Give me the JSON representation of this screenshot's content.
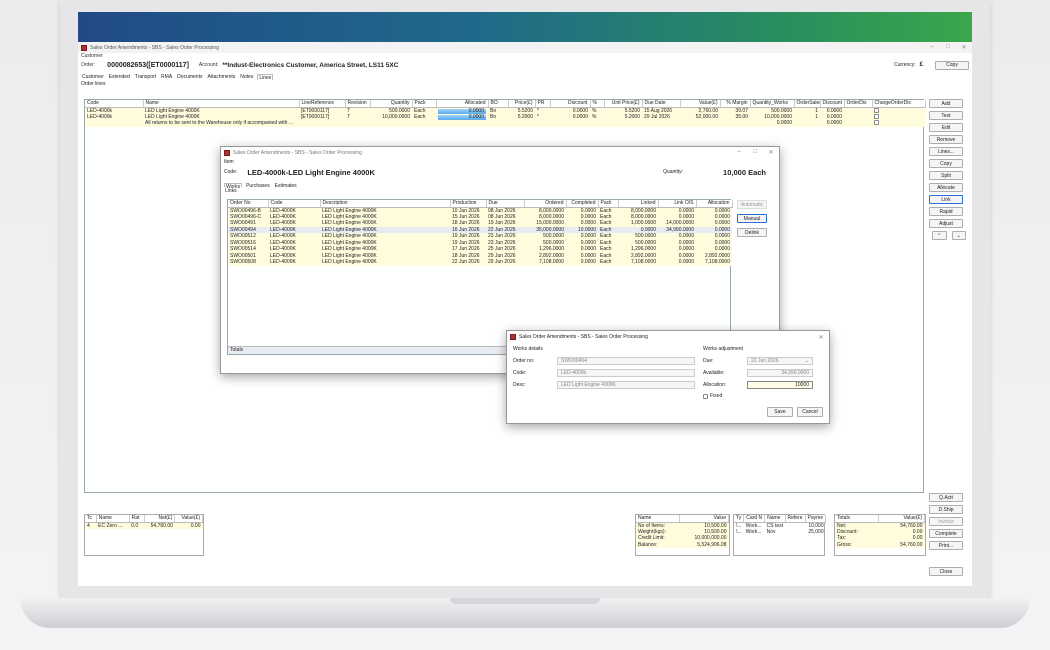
{
  "main": {
    "title": "Sales Order Amendments - SBS - Sales Order Processing",
    "customer_label": "Customer",
    "order_label": "Order:",
    "order_no": "0000082653([ET0000117]",
    "account_label": "Account:",
    "account_value": "**Indust-Electronics Customer, America Street, LS11 5XC",
    "currency_label": "Currency:",
    "currency_symbol": "£",
    "copy_button": "Copy",
    "tabs": [
      "Customer",
      "Extended",
      "Transport",
      "RMA",
      "Documents",
      "Attachments",
      "Notes",
      "Lines"
    ],
    "group_label": "Order lines",
    "columns": [
      "Code",
      "Name",
      "LineReference",
      "Revision",
      "Quantity",
      "Pack",
      "Allocated",
      "BO",
      "Price(£)",
      "PR",
      "Discount",
      "%",
      "Unit Price(£)",
      "Due Date",
      "Value(£)",
      "% Margin",
      "Quantity_Works",
      "OrderSales",
      "Discount",
      "OrderDis",
      "ChargeOrderDis"
    ],
    "rows": [
      {
        "code": "LED-4000k",
        "name": "LED Light Engine 4000K",
        "ref": "[ET0000117]",
        "rev": "7",
        "qty": "500.0000",
        "pack": "Each",
        "alloc": "0.0000",
        "bo": "Bo",
        "price": "5.5200",
        "pr": "*",
        "disc": "0.0000",
        "pct": "%",
        "unit": "5.5200",
        "due": "15 Aug 2026",
        "value": "2,760.00",
        "margin": "39.07",
        "qworks": "500.0000",
        "osales": "1",
        "disc2": "0.0000"
      },
      {
        "code": "LED-4000k",
        "name": "LED Light Engine 4000K",
        "ref": "[ET0000117]",
        "rev": "7",
        "qty": "10,000.0000",
        "pack": "Each",
        "alloc": "0.0000",
        "bo": "Bo",
        "price": "5.2000",
        "pr": "*",
        "disc": "0.0000",
        "pct": "%",
        "unit": "5.2000",
        "due": "29 Jul 2026",
        "value": "52,000.00",
        "margin": "35.00",
        "qworks": "10,000.0000",
        "osales": "1",
        "disc2": "0.0000"
      }
    ],
    "note_row": {
      "name": "All returns to be sent to the Warehouse only if accompanied with ...",
      "qworks": "0.0000",
      "disc2": "0.0000"
    },
    "right_buttons": [
      "Add",
      "Text",
      "Edit",
      "Remove",
      "Lines...",
      "Copy",
      "Split",
      "Allocate",
      "Link",
      "Rapid",
      "Adjust"
    ],
    "right_buttons2": [
      "Q.Actt",
      "D.Ship",
      "Invoice",
      "Complete",
      "Print..."
    ],
    "close_button": "Close",
    "tax_panel": {
      "columns": [
        "Tc",
        "Name",
        "Rat",
        "Net(£)",
        "Value(£)"
      ],
      "row": [
        "4",
        "EC Zero ...",
        "0.0",
        "54,760.00",
        "0.00"
      ]
    },
    "info_panel": {
      "columns": [
        "Name",
        "Value"
      ],
      "rows": [
        [
          "No of Items:",
          "10,500.00"
        ],
        [
          "Weight(kgs):",
          "10,500.00"
        ],
        [
          "Credit Limit:",
          "10,000,000.00"
        ],
        [
          "Balance:",
          "5,524,906.08"
        ]
      ]
    },
    "card_panel": {
      "columns": [
        "Ty",
        "Card N",
        "Name",
        "Refere",
        "Payme"
      ],
      "rows": [
        [
          "\\...",
          "Work...",
          "CS test",
          "",
          "10,000"
        ],
        [
          "\\...",
          "Work...",
          "Nov",
          "",
          "25,000"
        ]
      ]
    },
    "totals_panel": {
      "columns": [
        "Totals",
        "Value(£)"
      ],
      "rows": [
        [
          "Net:",
          "54,760.00"
        ],
        [
          "Discount:",
          "0.00"
        ],
        [
          "Tax:",
          "0.00"
        ],
        [
          "Gross:",
          "54,760.00"
        ]
      ]
    }
  },
  "dialog1": {
    "title": "Sales Order Amendments - SBS - Sales Order Processing",
    "item_label": "Item",
    "code_label": "Code:",
    "code_value": "LED-4000k-LED Light Engine 4000K",
    "quantity_label": "Quantity:",
    "quantity_value": "10,000 Each",
    "tabs": [
      "Works",
      "Purchases",
      "Estimates"
    ],
    "group_label": "Links",
    "columns": [
      "Order No",
      "Code",
      "Description",
      "Production",
      "Due",
      "Ordered",
      "Completed",
      "Pack",
      "Linked",
      "Link O/S",
      "Allocation"
    ],
    "rows": [
      [
        "SWO00496-B",
        "LED-4000K",
        "LED Light Engine 4000K",
        "10 Jun 2026",
        "08 Jun 2026",
        "8,000.0000",
        "0.0000",
        "Each",
        "8,000.0000",
        "0.0000",
        "0.0000"
      ],
      [
        "SWO00496-C",
        "LED-4000K",
        "LED Light Engine 4000K",
        "15 Jun 2026",
        "08 Jun 2026",
        "8,000.0000",
        "0.0000",
        "Each",
        "8,000.0000",
        "0.0000",
        "0.0000"
      ],
      [
        "SWO00491",
        "LED-4000K",
        "LED Light Engine 4000K",
        "18 Jun 2026",
        "19 Jun 2026",
        "15,000.0000",
        "0.0000",
        "Each",
        "1,000.0000",
        "14,000.0000",
        "0.0000"
      ],
      [
        "SWO00494",
        "LED-4000K",
        "LED Light Engine 4000K",
        "16 Jun 2026",
        "22 Jun 2026",
        "35,000.0000",
        "10.0000",
        "Each",
        "0.0000",
        "34,990.0000",
        "0.0000"
      ],
      [
        "SWO00512",
        "LED-4000K",
        "LED Light Engine 4000K",
        "19 Jun 2026",
        "23 Jun 2026",
        "500.0000",
        "0.0000",
        "Each",
        "500.0000",
        "0.0000",
        "0.0000"
      ],
      [
        "SWO00516",
        "LED-4000K",
        "LED Light Engine 4000K",
        "19 Jun 2026",
        "23 Jun 2026",
        "500.0000",
        "0.0000",
        "Each",
        "500.0000",
        "0.0000",
        "0.0000"
      ],
      [
        "SWO00514",
        "LED-4000K",
        "LED Light Engine 4000K",
        "17 Jun 2026",
        "25 Jun 2026",
        "1,296.0000",
        "0.0000",
        "Each",
        "1,296.0000",
        "0.0000",
        "0.0000"
      ],
      [
        "SWO00501",
        "LED-4000K",
        "LED Light Engine 4000K",
        "18 Jun 2026",
        "29 Jun 2026",
        "2,892.0000",
        "0.0000",
        "Each",
        "2,892.0000",
        "0.0000",
        "2,892.0000"
      ],
      [
        "SWO00508",
        "LED-4000K",
        "LED Light Engine 4000K",
        "22 Jun 2026",
        "29 Jun 2026",
        "7,108.0000",
        "0.0000",
        "Each",
        "7,108.0000",
        "0.0000",
        "7,108.0000"
      ]
    ],
    "totals_label": "Totals",
    "buttons": [
      "Automatic",
      "Manual",
      "Delink"
    ]
  },
  "dialog2": {
    "title": "Sales Order Amendments - SBS - Sales Order Processing",
    "details_label": "Works details",
    "order_no_label": "Order no:",
    "order_no_value": "SWO00494",
    "code_label": "Code:",
    "code_value": "LED-4000k",
    "desc_label": "Desc:",
    "desc_value": "LED Light Engine 4000K",
    "adjust_label": "Works adjustment",
    "due_label": "Due:",
    "due_value": "22 Jun 2026",
    "available_label": "Available:",
    "available_value": "34,990.0000",
    "allocation_label": "Allocation:",
    "allocation_value": "10000",
    "fixed_label": "Fixed",
    "save_button": "Save",
    "cancel_button": "Cancel"
  }
}
